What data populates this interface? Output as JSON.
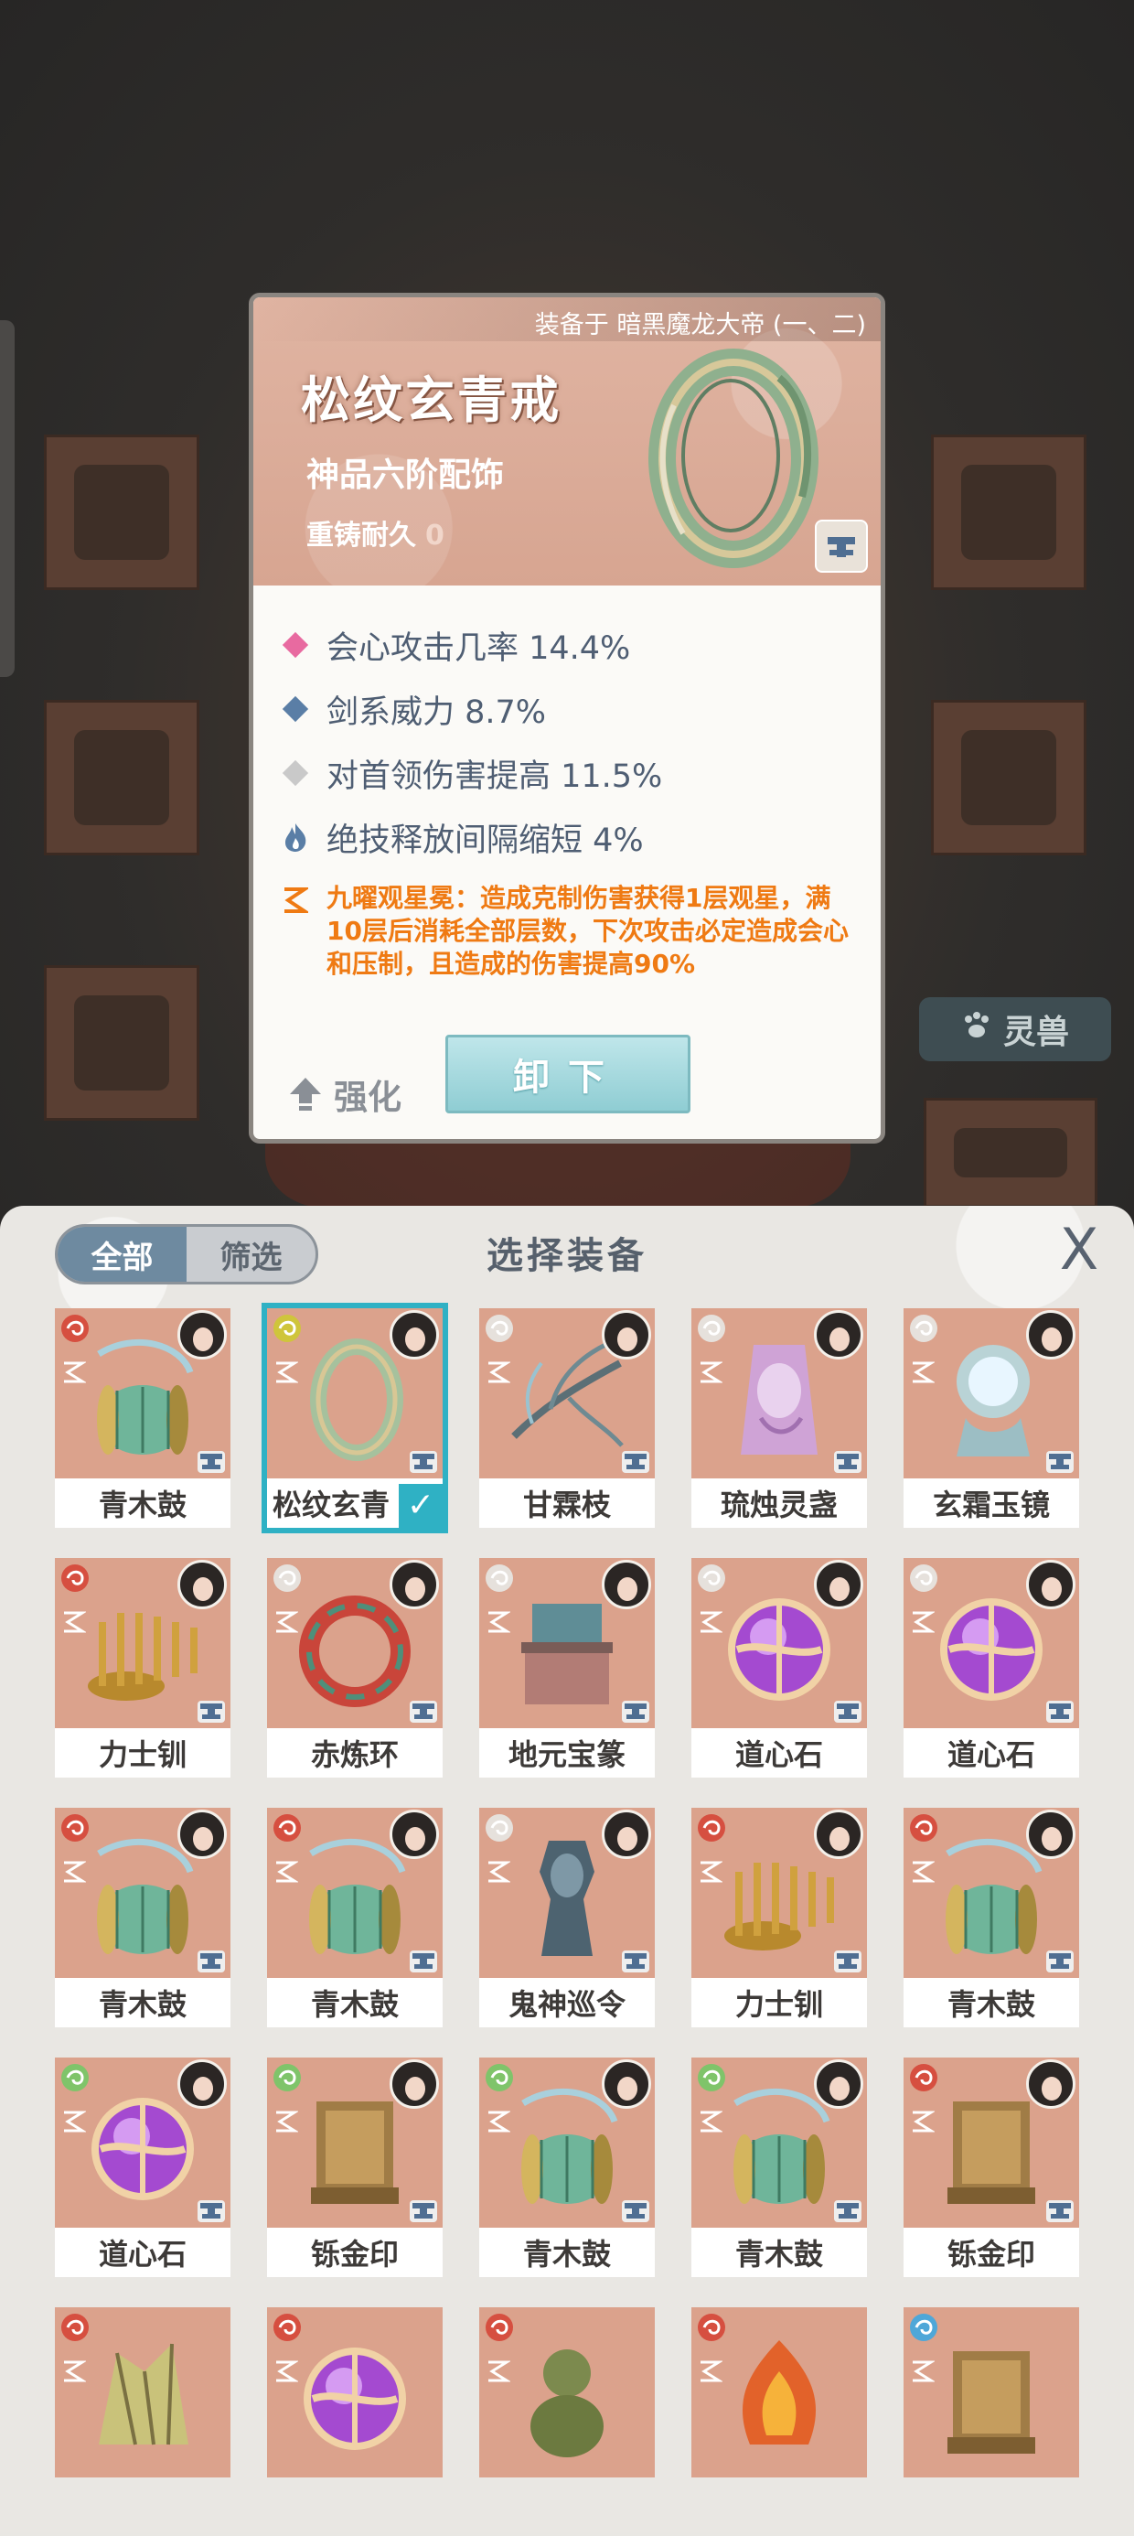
{
  "detail": {
    "equipped_on": "装备于 暗黑魔龙大帝 (一、二)",
    "name": "松纹玄青戒",
    "grade": "神品六阶配饰",
    "recast_label": "重铸耐久",
    "recast_value": "0",
    "stats": [
      {
        "text": "会心攻击几率 14.4%",
        "color": "#e86aa0",
        "shape": "diamond"
      },
      {
        "text": "剑系威力 8.7%",
        "color": "#5a7ea6",
        "shape": "diamond"
      },
      {
        "text": "对首领伤害提高 11.5%",
        "color": "#c9c9c9",
        "shape": "diamond"
      },
      {
        "text": "绝技释放间隔缩短 4%",
        "color": "#5a7ea6",
        "shape": "flame"
      }
    ],
    "skill_text": "九曜观星冕：造成克制伤害获得1层观星，满10层后消耗全部层数，下次攻击必定造成会心和压制，且造成的伤害提高90%",
    "strengthen_label": "强化",
    "unequip_label": "卸下"
  },
  "background": {
    "beast_label": "灵兽"
  },
  "panel": {
    "title": "选择装备",
    "filter_all": "全部",
    "filter_pick": "筛选",
    "close_label": "X"
  },
  "items": [
    {
      "name": "青木鼓",
      "kind": "drum",
      "sect": "#d64f40",
      "selected": false
    },
    {
      "name": "松纹玄青",
      "kind": "ring",
      "sect": "#cfc53b",
      "selected": true
    },
    {
      "name": "甘霖枝",
      "kind": "branch",
      "sect": "#e6e1dc",
      "selected": false
    },
    {
      "name": "琉烛灵盏",
      "kind": "lamp",
      "sect": "#e6e1dc",
      "selected": false
    },
    {
      "name": "玄霜玉镜",
      "kind": "mirror",
      "sect": "#e6e1dc",
      "selected": false
    },
    {
      "name": "力士钏",
      "kind": "spring",
      "sect": "#d64f40",
      "selected": false
    },
    {
      "name": "赤炼环",
      "kind": "fire-ring",
      "sect": "#e6e1dc",
      "selected": false
    },
    {
      "name": "地元宝篆",
      "kind": "cauldron",
      "sect": "#e6e1dc",
      "selected": false
    },
    {
      "name": "道心石",
      "kind": "orb",
      "sect": "#e6e1dc",
      "selected": false
    },
    {
      "name": "道心石",
      "kind": "orb",
      "sect": "#e6e1dc",
      "selected": false
    },
    {
      "name": "青木鼓",
      "kind": "drum",
      "sect": "#d64f40",
      "selected": false
    },
    {
      "name": "青木鼓",
      "kind": "drum",
      "sect": "#d64f40",
      "selected": false
    },
    {
      "name": "鬼神巡令",
      "kind": "token",
      "sect": "#e6e1dc",
      "selected": false
    },
    {
      "name": "力士钏",
      "kind": "spring",
      "sect": "#d64f40",
      "selected": false
    },
    {
      "name": "青木鼓",
      "kind": "drum",
      "sect": "#d64f40",
      "selected": false
    },
    {
      "name": "道心石",
      "kind": "orb",
      "sect": "#7fc46a",
      "selected": false
    },
    {
      "name": "铄金印",
      "kind": "seal",
      "sect": "#7fc46a",
      "selected": false
    },
    {
      "name": "青木鼓",
      "kind": "drum",
      "sect": "#7fc46a",
      "selected": false
    },
    {
      "name": "青木鼓",
      "kind": "drum",
      "sect": "#7fc46a",
      "selected": false
    },
    {
      "name": "铄金印",
      "kind": "seal",
      "sect": "#d64f40",
      "selected": false
    },
    {
      "name": "",
      "kind": "crystal",
      "sect": "#d64f40",
      "selected": false
    },
    {
      "name": "",
      "kind": "orb",
      "sect": "#d64f40",
      "selected": false
    },
    {
      "name": "",
      "kind": "gourd",
      "sect": "#d64f40",
      "selected": false
    },
    {
      "name": "",
      "kind": "flame",
      "sect": "#d64f40",
      "selected": false
    },
    {
      "name": "",
      "kind": "seal",
      "sect": "#4fa7d8",
      "selected": false
    }
  ]
}
